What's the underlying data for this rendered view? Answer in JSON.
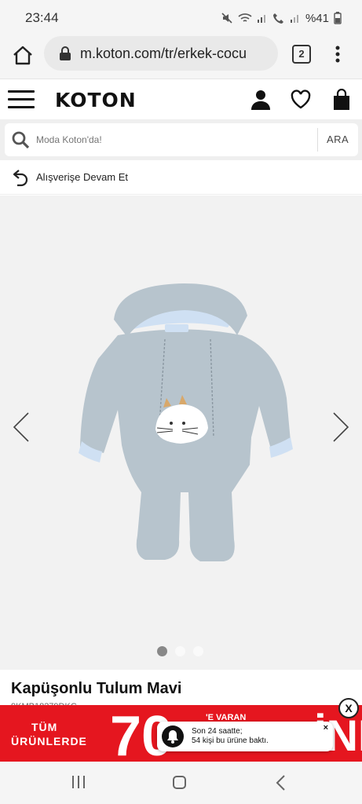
{
  "status_bar": {
    "time": "23:44",
    "battery": "%41"
  },
  "browser": {
    "url": "m.koton.com/tr/erkek-cocu",
    "tab_count": "2"
  },
  "header": {
    "logo": "KOTON"
  },
  "search": {
    "placeholder": "Moda Koton'da!",
    "button": "ARA"
  },
  "back": {
    "label": "Alışverişe Devam Et"
  },
  "product": {
    "title": "Kapüşonlu Tulum Mavi",
    "code": "9KMB18279DKC"
  },
  "promo": {
    "line1": "TÜM",
    "line2": "ÜRÜNLERDE",
    "big": "70",
    "small": "'E VARAN",
    "word": "İNDİRİM!",
    "close": "X"
  },
  "toast": {
    "line1": "Son 24 saatte;",
    "line2": "54 kişi bu ürüne baktı.",
    "close": "×"
  },
  "gallery": {
    "dots": 3,
    "active_dot": 1
  },
  "colors": {
    "promo_red": "#e5161f",
    "garment": "#b7c4cd",
    "lining": "#cfe0f3"
  }
}
